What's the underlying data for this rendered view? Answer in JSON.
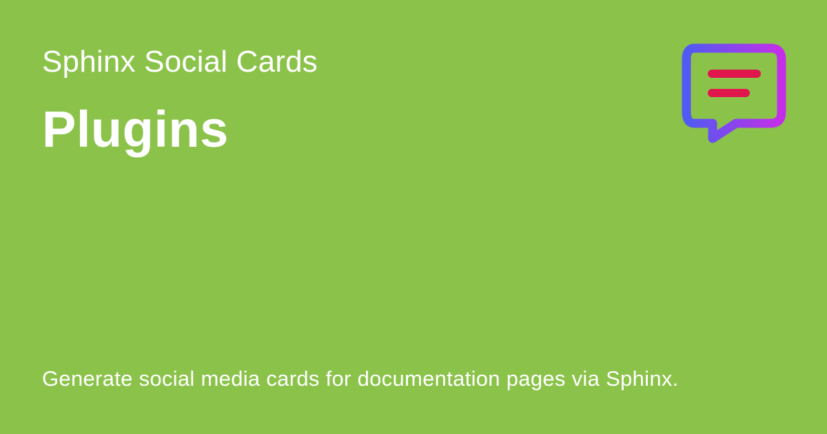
{
  "card": {
    "site_name": "Sphinx Social Cards",
    "page_title": "Plugins",
    "description": "Generate social media cards for documentation pages via Sphinx."
  },
  "logo": {
    "icon": "chat-bubble-icon",
    "gradient_start": "#4f5bf2",
    "gradient_end": "#c52ee8",
    "line_color": "#e0174d"
  },
  "colors": {
    "background": "#8bc34a",
    "text": "#ffffff"
  }
}
